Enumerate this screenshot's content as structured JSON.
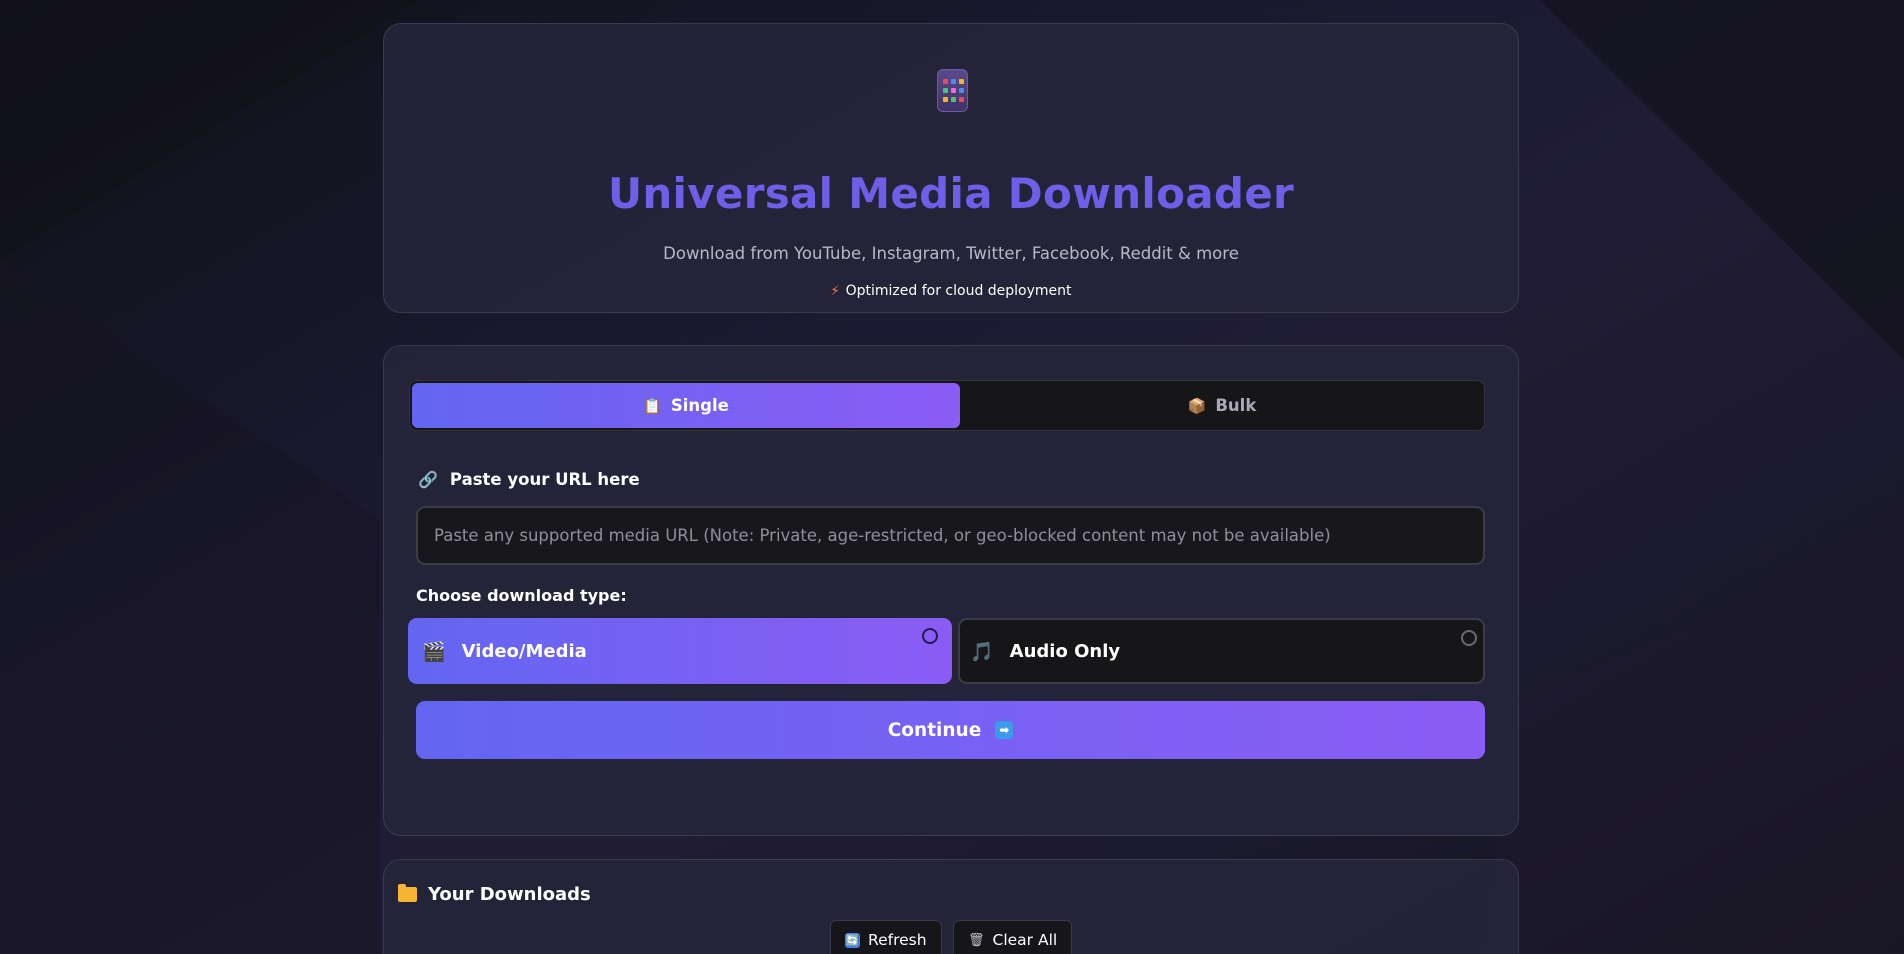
{
  "header": {
    "title": "Universal Media Downloader",
    "subtitle": "Download from YouTube, Instagram, Twitter, Facebook, Reddit & more",
    "badge": "Optimized for cloud deployment",
    "app_icon": "mobile-phone-icon",
    "badge_icon": "lightning-bolt-icon"
  },
  "tabs": {
    "single": {
      "label": "Single",
      "icon": "clipboard-icon",
      "active": true
    },
    "bulk": {
      "label": "Bulk",
      "icon": "package-box-icon",
      "active": false
    }
  },
  "url_field": {
    "label": "Paste your URL here",
    "icon": "link-icon",
    "value": "",
    "placeholder": "Paste any supported media URL (Note: Private, age-restricted, or geo-blocked content may not be available)"
  },
  "download_type": {
    "label": "Choose download type:",
    "options": [
      {
        "label": "Video/Media",
        "icon": "clapper-board-icon",
        "selected": true
      },
      {
        "label": "Audio Only",
        "icon": "music-note-icon",
        "selected": false
      }
    ]
  },
  "continue": {
    "label": "Continue",
    "icon": "right-arrow-icon"
  },
  "downloads": {
    "title": "Your Downloads",
    "icon": "folder-icon",
    "refresh_label": "Refresh",
    "clear_label": "Clear All"
  },
  "colors": {
    "accent_start": "#6366f1",
    "accent_end": "#8b5cf6",
    "title_color": "#6d5fe8",
    "card_bg": "#25253a",
    "bolt_color": "#ff7a45"
  }
}
